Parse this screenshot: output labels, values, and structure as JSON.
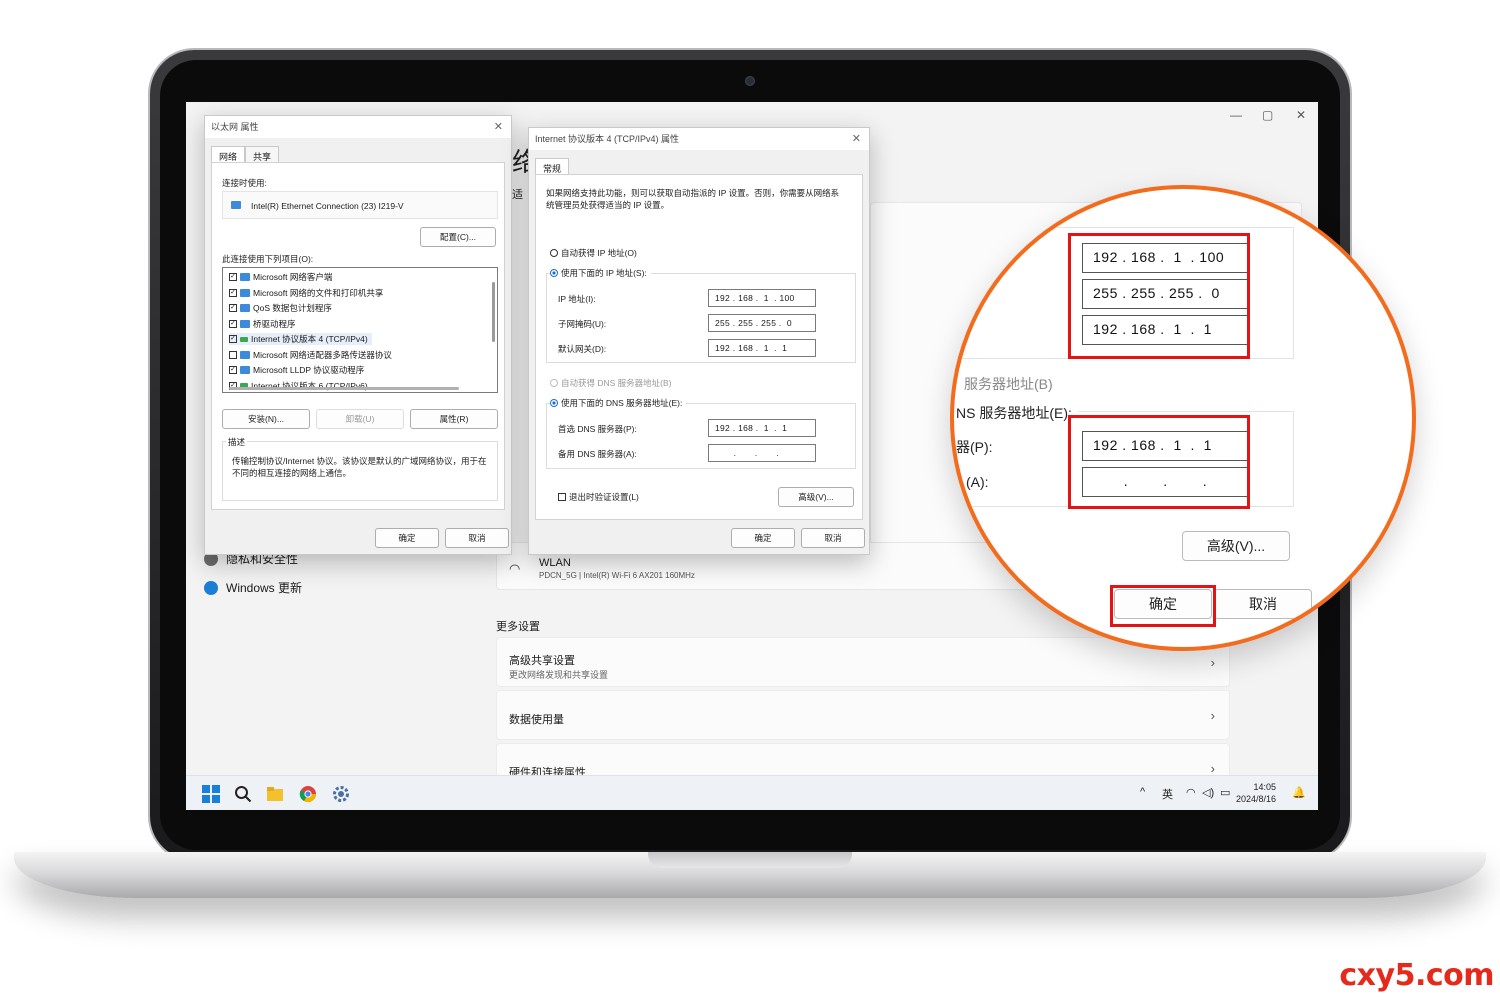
{
  "settings": {
    "title_partial": "络",
    "adapter_fragment": "适",
    "nav": {
      "privacy": "隐私和安全性",
      "update": "Windows 更新"
    },
    "wlan": {
      "name": "WLAN",
      "detail": "PDCN_5G | Intel(R) Wi-Fi 6 AX201 160MHz"
    },
    "more_settings": "更多设置",
    "rows": [
      {
        "title": "高级共享设置",
        "sub": "更改网络发现和共享设置"
      },
      {
        "title": "数据使用量",
        "sub": ""
      },
      {
        "title": "硬件和连接属性",
        "sub": ""
      }
    ],
    "window_controls": {
      "min": "—",
      "max": "▢",
      "close": "✕"
    }
  },
  "taskbar": {
    "tray_lang": "英",
    "time": "14:05",
    "date": "2024/8/16"
  },
  "eth_dialog": {
    "title": "以太网 属性",
    "tabs": [
      "网络",
      "共享"
    ],
    "connect_using_label": "连接时使用:",
    "adapter": "Intel(R) Ethernet Connection (23) I219-V",
    "configure_btn": "配置(C)...",
    "items_label": "此连接使用下列项目(O):",
    "items": [
      {
        "label": "Microsoft 网络客户端",
        "checked": true
      },
      {
        "label": "Microsoft 网络的文件和打印机共享",
        "checked": true
      },
      {
        "label": "QoS 数据包计划程序",
        "checked": true
      },
      {
        "label": "桥驱动程序",
        "checked": true
      },
      {
        "label": "Internet 协议版本 4 (TCP/IPv4)",
        "checked": true
      },
      {
        "label": "Microsoft 网络适配器多路传送器协议",
        "checked": false
      },
      {
        "label": "Microsoft LLDP 协议驱动程序",
        "checked": true
      },
      {
        "label": "Internet 协议版本 6 (TCP/IPv6)",
        "checked": true
      }
    ],
    "install_btn": "安装(N)...",
    "uninstall_btn": "卸载(U)",
    "properties_btn": "属性(R)",
    "desc_label": "描述",
    "description": "传输控制协议/Internet 协议。该协议是默认的广域网络协议，用于在不同的相互连接的网络上通信。",
    "ok_btn": "确定",
    "cancel_btn": "取消"
  },
  "ipv4_dialog": {
    "title": "Internet 协议版本 4 (TCP/IPv4) 属性",
    "tab": "常规",
    "intro": "如果网络支持此功能，则可以获取自动指派的 IP 设置。否则，你需要从网络系统管理员处获得适当的 IP 设置。",
    "auto_ip": "自动获得 IP 地址(O)",
    "manual_ip": "使用下面的 IP 地址(S):",
    "ip_label": "IP 地址(I):",
    "mask_label": "子网掩码(U):",
    "gateway_label": "默认网关(D):",
    "ip": "192 . 168 .  1  . 100",
    "mask": "255 . 255 . 255 .  0",
    "gateway": "192 . 168 .  1  .  1",
    "auto_dns": "自动获得 DNS 服务器地址(B)",
    "manual_dns": "使用下面的 DNS 服务器地址(E):",
    "pref_dns_label": "首选 DNS 服务器(P):",
    "alt_dns_label": "备用 DNS 服务器(A):",
    "pref_dns": "192 . 168 .  1  .  1",
    "alt_dns": "       .       .       .",
    "validate": "退出时验证设置(L)",
    "advanced_btn": "高级(V)...",
    "ok_btn": "确定",
    "cancel_btn": "取消"
  },
  "zoom": {
    "ip": "192 . 168 .  1  . 100",
    "mask": "255 . 255 . 255 .  0",
    "gateway": "192 . 168 .  1  .  1",
    "auto_dns_partial": "服务器地址(B)",
    "manual_dns_partial": "NS 服务器地址(E):",
    "pref_partial": "器(P):",
    "alt_partial": "(A):",
    "pref_dns": "192 . 168 .  1  .  1",
    "alt_dns": "       .        .        .",
    "advanced_btn": "高级(V)...",
    "ok_btn": "确定",
    "cancel_btn": "取消",
    "ring_color": "#f36b1c",
    "highlight_color": "#e41414"
  },
  "watermark": "cxy5.com"
}
